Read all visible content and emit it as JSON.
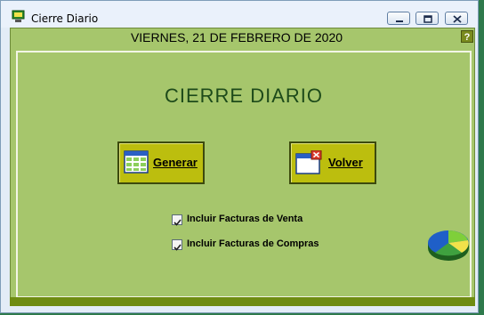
{
  "window": {
    "title": "Cierre Diario",
    "minimize_icon": "minimize-icon",
    "maximize_icon": "maximize-icon",
    "close_icon": "close-icon"
  },
  "header": {
    "date": "VIERNES, 21 DE FEBRERO DE 2020",
    "help_label": "?"
  },
  "main": {
    "heading": "CIERRE DIARIO",
    "generate_label": "Generar",
    "back_label": "Volver",
    "checkboxes": [
      {
        "label": "Incluir Facturas de Venta",
        "checked": true
      },
      {
        "label": "Incluir Facturas de Compras",
        "checked": true
      }
    ]
  },
  "colors": {
    "background": "#a6c66c",
    "button": "#bcbe0e",
    "heading": "#1d4a1a"
  }
}
